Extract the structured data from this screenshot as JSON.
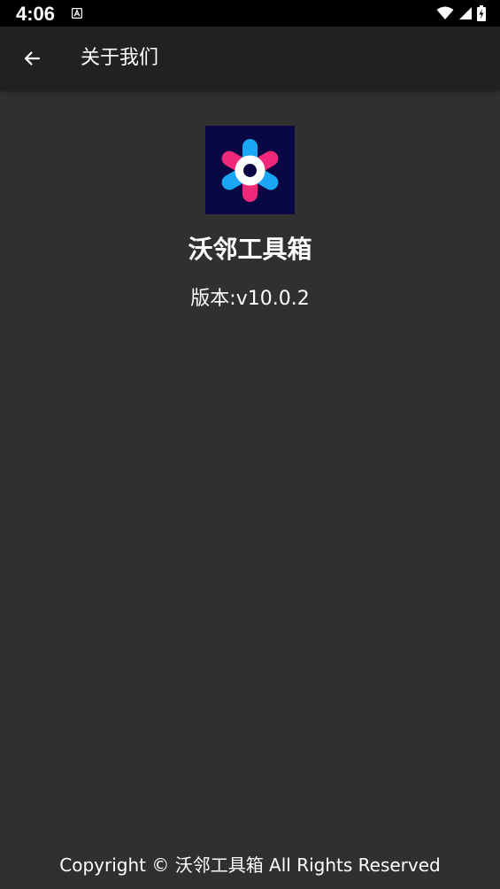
{
  "status_bar": {
    "time": "4:06",
    "icons": [
      "notification-a-icon",
      "wifi-icon",
      "signal-icon",
      "battery-charging-icon"
    ]
  },
  "app_bar": {
    "back_icon": "arrow-left-icon",
    "title": "关于我们"
  },
  "about": {
    "app_name": "沃邻工具箱",
    "version": "版本:v10.0.2"
  },
  "footer": {
    "copyright": "Copyright © 沃邻工具箱 All Rights Reserved"
  },
  "colors": {
    "background": "#303030",
    "app_bar": "#212121",
    "status_bar": "#000000",
    "icon_bg": "#0a0844",
    "logo_pink": "#f0287a",
    "logo_blue": "#1aa6f2",
    "logo_center": "#0a0844"
  }
}
